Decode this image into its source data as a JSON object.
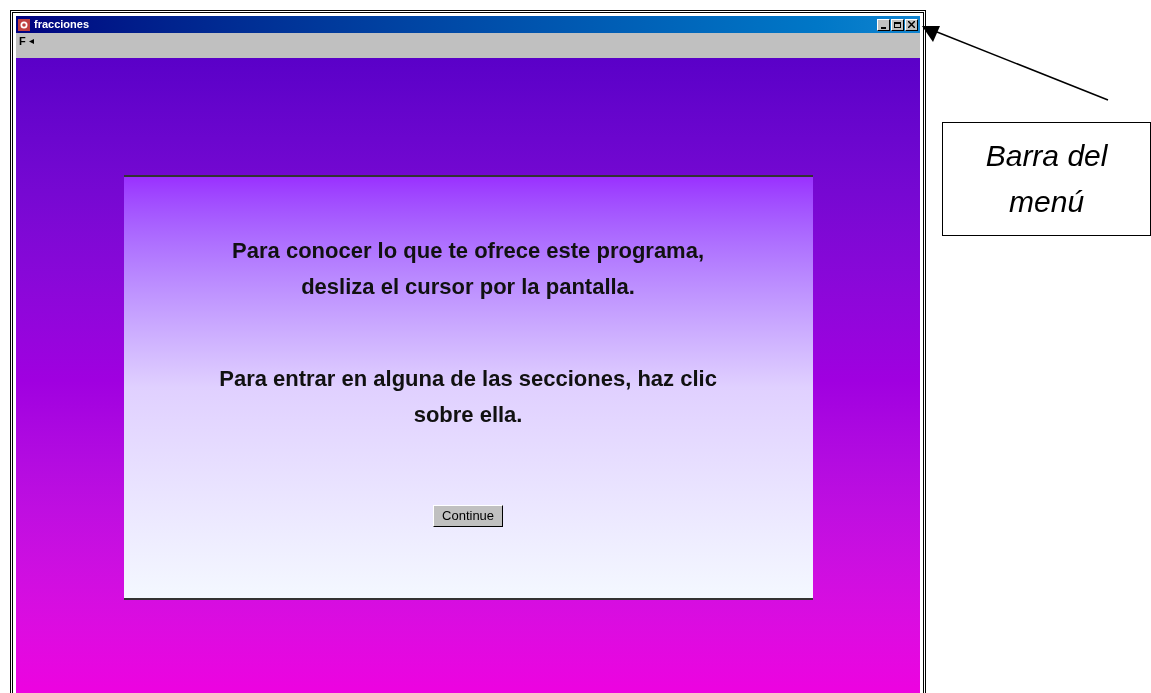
{
  "window": {
    "title": "fracciones"
  },
  "menu": [
    {
      "label": "F"
    }
  ],
  "panel": {
    "paragraphs": [
      "Para conocer lo que te ofrece este programa, desliza el cursor por la pantalla.",
      "Para entrar en alguna de las secciones, haz clic sobre ella."
    ],
    "button": "Continue"
  },
  "callout": {
    "text": "Barra del menú"
  }
}
